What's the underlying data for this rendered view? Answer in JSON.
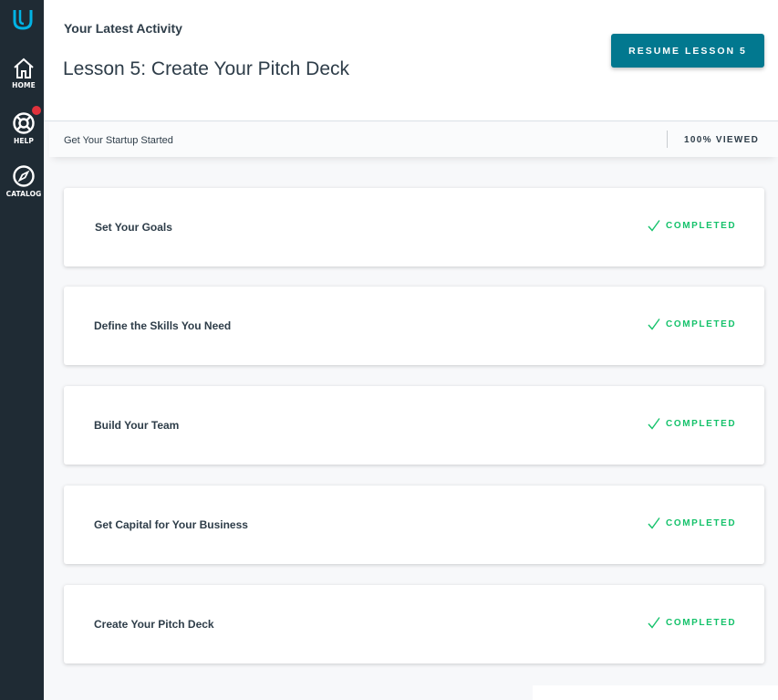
{
  "colors": {
    "sidebar": "#1f2b34",
    "accent": "#02b3e4",
    "button": "#02788f",
    "completed": "#15c26b",
    "notification": "#e0323c"
  },
  "sidebar": {
    "logo_icon": "udacity-logo-icon",
    "items": [
      {
        "label": "HOME",
        "icon": "home-icon"
      },
      {
        "label": "HELP",
        "icon": "lifebuoy-icon"
      },
      {
        "label": "CATALOG",
        "icon": "compass-icon"
      }
    ]
  },
  "header": {
    "activity_label": "Your Latest Activity",
    "lesson_title": "Lesson 5: Create Your Pitch Deck",
    "resume_button": "RESUME LESSON 5"
  },
  "course": {
    "name": "Get Your Startup Started",
    "viewed": "100% VIEWED"
  },
  "lessons": [
    {
      "title": "Set Your Goals",
      "status": "COMPLETED"
    },
    {
      "title": "Define the Skills You Need",
      "status": "COMPLETED"
    },
    {
      "title": "Build Your Team",
      "status": "COMPLETED"
    },
    {
      "title": "Get Capital for Your Business",
      "status": "COMPLETED"
    },
    {
      "title": "Create Your Pitch Deck",
      "status": "COMPLETED"
    }
  ]
}
